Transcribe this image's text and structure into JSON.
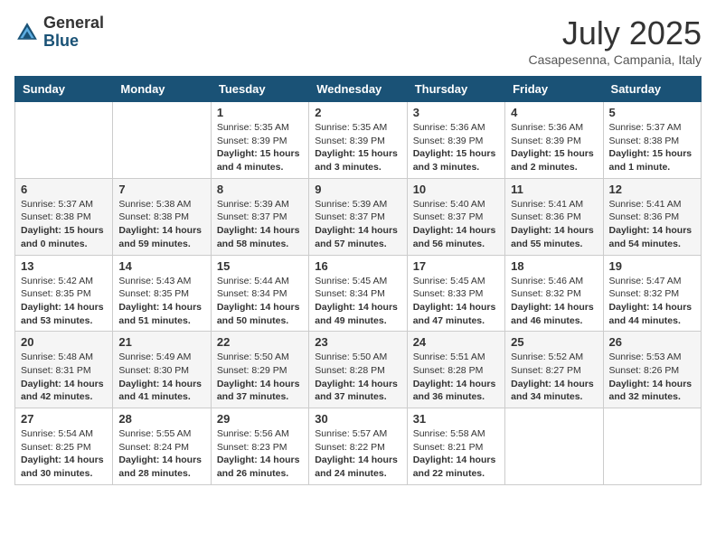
{
  "header": {
    "logo_general": "General",
    "logo_blue": "Blue",
    "month": "July 2025",
    "location": "Casapesenna, Campania, Italy"
  },
  "weekdays": [
    "Sunday",
    "Monday",
    "Tuesday",
    "Wednesday",
    "Thursday",
    "Friday",
    "Saturday"
  ],
  "weeks": [
    [
      {
        "day": "",
        "info": ""
      },
      {
        "day": "",
        "info": ""
      },
      {
        "day": "1",
        "info": "Sunrise: 5:35 AM\nSunset: 8:39 PM\nDaylight: 15 hours and 4 minutes."
      },
      {
        "day": "2",
        "info": "Sunrise: 5:35 AM\nSunset: 8:39 PM\nDaylight: 15 hours and 3 minutes."
      },
      {
        "day": "3",
        "info": "Sunrise: 5:36 AM\nSunset: 8:39 PM\nDaylight: 15 hours and 3 minutes."
      },
      {
        "day": "4",
        "info": "Sunrise: 5:36 AM\nSunset: 8:39 PM\nDaylight: 15 hours and 2 minutes."
      },
      {
        "day": "5",
        "info": "Sunrise: 5:37 AM\nSunset: 8:38 PM\nDaylight: 15 hours and 1 minute."
      }
    ],
    [
      {
        "day": "6",
        "info": "Sunrise: 5:37 AM\nSunset: 8:38 PM\nDaylight: 15 hours and 0 minutes."
      },
      {
        "day": "7",
        "info": "Sunrise: 5:38 AM\nSunset: 8:38 PM\nDaylight: 14 hours and 59 minutes."
      },
      {
        "day": "8",
        "info": "Sunrise: 5:39 AM\nSunset: 8:37 PM\nDaylight: 14 hours and 58 minutes."
      },
      {
        "day": "9",
        "info": "Sunrise: 5:39 AM\nSunset: 8:37 PM\nDaylight: 14 hours and 57 minutes."
      },
      {
        "day": "10",
        "info": "Sunrise: 5:40 AM\nSunset: 8:37 PM\nDaylight: 14 hours and 56 minutes."
      },
      {
        "day": "11",
        "info": "Sunrise: 5:41 AM\nSunset: 8:36 PM\nDaylight: 14 hours and 55 minutes."
      },
      {
        "day": "12",
        "info": "Sunrise: 5:41 AM\nSunset: 8:36 PM\nDaylight: 14 hours and 54 minutes."
      }
    ],
    [
      {
        "day": "13",
        "info": "Sunrise: 5:42 AM\nSunset: 8:35 PM\nDaylight: 14 hours and 53 minutes."
      },
      {
        "day": "14",
        "info": "Sunrise: 5:43 AM\nSunset: 8:35 PM\nDaylight: 14 hours and 51 minutes."
      },
      {
        "day": "15",
        "info": "Sunrise: 5:44 AM\nSunset: 8:34 PM\nDaylight: 14 hours and 50 minutes."
      },
      {
        "day": "16",
        "info": "Sunrise: 5:45 AM\nSunset: 8:34 PM\nDaylight: 14 hours and 49 minutes."
      },
      {
        "day": "17",
        "info": "Sunrise: 5:45 AM\nSunset: 8:33 PM\nDaylight: 14 hours and 47 minutes."
      },
      {
        "day": "18",
        "info": "Sunrise: 5:46 AM\nSunset: 8:32 PM\nDaylight: 14 hours and 46 minutes."
      },
      {
        "day": "19",
        "info": "Sunrise: 5:47 AM\nSunset: 8:32 PM\nDaylight: 14 hours and 44 minutes."
      }
    ],
    [
      {
        "day": "20",
        "info": "Sunrise: 5:48 AM\nSunset: 8:31 PM\nDaylight: 14 hours and 42 minutes."
      },
      {
        "day": "21",
        "info": "Sunrise: 5:49 AM\nSunset: 8:30 PM\nDaylight: 14 hours and 41 minutes."
      },
      {
        "day": "22",
        "info": "Sunrise: 5:50 AM\nSunset: 8:29 PM\nDaylight: 14 hours and 37 minutes."
      },
      {
        "day": "23",
        "info": "Sunrise: 5:50 AM\nSunset: 8:28 PM\nDaylight: 14 hours and 37 minutes."
      },
      {
        "day": "24",
        "info": "Sunrise: 5:51 AM\nSunset: 8:28 PM\nDaylight: 14 hours and 36 minutes."
      },
      {
        "day": "25",
        "info": "Sunrise: 5:52 AM\nSunset: 8:27 PM\nDaylight: 14 hours and 34 minutes."
      },
      {
        "day": "26",
        "info": "Sunrise: 5:53 AM\nSunset: 8:26 PM\nDaylight: 14 hours and 32 minutes."
      }
    ],
    [
      {
        "day": "27",
        "info": "Sunrise: 5:54 AM\nSunset: 8:25 PM\nDaylight: 14 hours and 30 minutes."
      },
      {
        "day": "28",
        "info": "Sunrise: 5:55 AM\nSunset: 8:24 PM\nDaylight: 14 hours and 28 minutes."
      },
      {
        "day": "29",
        "info": "Sunrise: 5:56 AM\nSunset: 8:23 PM\nDaylight: 14 hours and 26 minutes."
      },
      {
        "day": "30",
        "info": "Sunrise: 5:57 AM\nSunset: 8:22 PM\nDaylight: 14 hours and 24 minutes."
      },
      {
        "day": "31",
        "info": "Sunrise: 5:58 AM\nSunset: 8:21 PM\nDaylight: 14 hours and 22 minutes."
      },
      {
        "day": "",
        "info": ""
      },
      {
        "day": "",
        "info": ""
      }
    ]
  ]
}
